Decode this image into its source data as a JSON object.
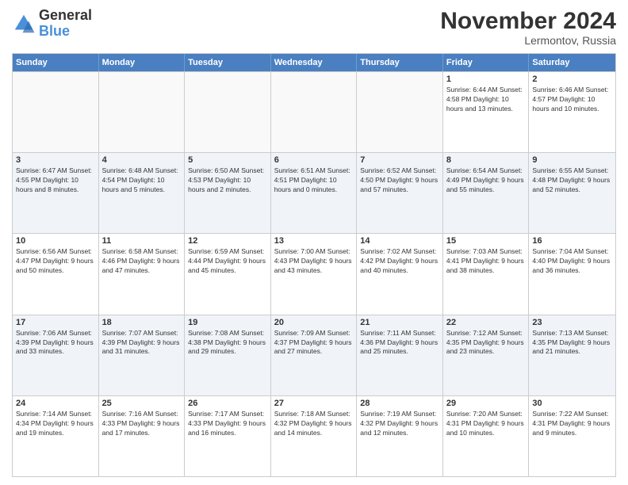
{
  "logo": {
    "text_general": "General",
    "text_blue": "Blue"
  },
  "title": "November 2024",
  "location": "Lermontov, Russia",
  "header_days": [
    "Sunday",
    "Monday",
    "Tuesday",
    "Wednesday",
    "Thursday",
    "Friday",
    "Saturday"
  ],
  "weeks": [
    [
      {
        "day": "",
        "info": "",
        "empty": true
      },
      {
        "day": "",
        "info": "",
        "empty": true
      },
      {
        "day": "",
        "info": "",
        "empty": true
      },
      {
        "day": "",
        "info": "",
        "empty": true
      },
      {
        "day": "",
        "info": "",
        "empty": true
      },
      {
        "day": "1",
        "info": "Sunrise: 6:44 AM\nSunset: 4:58 PM\nDaylight: 10 hours\nand 13 minutes."
      },
      {
        "day": "2",
        "info": "Sunrise: 6:46 AM\nSunset: 4:57 PM\nDaylight: 10 hours\nand 10 minutes."
      }
    ],
    [
      {
        "day": "3",
        "info": "Sunrise: 6:47 AM\nSunset: 4:55 PM\nDaylight: 10 hours\nand 8 minutes."
      },
      {
        "day": "4",
        "info": "Sunrise: 6:48 AM\nSunset: 4:54 PM\nDaylight: 10 hours\nand 5 minutes."
      },
      {
        "day": "5",
        "info": "Sunrise: 6:50 AM\nSunset: 4:53 PM\nDaylight: 10 hours\nand 2 minutes."
      },
      {
        "day": "6",
        "info": "Sunrise: 6:51 AM\nSunset: 4:51 PM\nDaylight: 10 hours\nand 0 minutes."
      },
      {
        "day": "7",
        "info": "Sunrise: 6:52 AM\nSunset: 4:50 PM\nDaylight: 9 hours\nand 57 minutes."
      },
      {
        "day": "8",
        "info": "Sunrise: 6:54 AM\nSunset: 4:49 PM\nDaylight: 9 hours\nand 55 minutes."
      },
      {
        "day": "9",
        "info": "Sunrise: 6:55 AM\nSunset: 4:48 PM\nDaylight: 9 hours\nand 52 minutes."
      }
    ],
    [
      {
        "day": "10",
        "info": "Sunrise: 6:56 AM\nSunset: 4:47 PM\nDaylight: 9 hours\nand 50 minutes."
      },
      {
        "day": "11",
        "info": "Sunrise: 6:58 AM\nSunset: 4:46 PM\nDaylight: 9 hours\nand 47 minutes."
      },
      {
        "day": "12",
        "info": "Sunrise: 6:59 AM\nSunset: 4:44 PM\nDaylight: 9 hours\nand 45 minutes."
      },
      {
        "day": "13",
        "info": "Sunrise: 7:00 AM\nSunset: 4:43 PM\nDaylight: 9 hours\nand 43 minutes."
      },
      {
        "day": "14",
        "info": "Sunrise: 7:02 AM\nSunset: 4:42 PM\nDaylight: 9 hours\nand 40 minutes."
      },
      {
        "day": "15",
        "info": "Sunrise: 7:03 AM\nSunset: 4:41 PM\nDaylight: 9 hours\nand 38 minutes."
      },
      {
        "day": "16",
        "info": "Sunrise: 7:04 AM\nSunset: 4:40 PM\nDaylight: 9 hours\nand 36 minutes."
      }
    ],
    [
      {
        "day": "17",
        "info": "Sunrise: 7:06 AM\nSunset: 4:39 PM\nDaylight: 9 hours\nand 33 minutes."
      },
      {
        "day": "18",
        "info": "Sunrise: 7:07 AM\nSunset: 4:39 PM\nDaylight: 9 hours\nand 31 minutes."
      },
      {
        "day": "19",
        "info": "Sunrise: 7:08 AM\nSunset: 4:38 PM\nDaylight: 9 hours\nand 29 minutes."
      },
      {
        "day": "20",
        "info": "Sunrise: 7:09 AM\nSunset: 4:37 PM\nDaylight: 9 hours\nand 27 minutes."
      },
      {
        "day": "21",
        "info": "Sunrise: 7:11 AM\nSunset: 4:36 PM\nDaylight: 9 hours\nand 25 minutes."
      },
      {
        "day": "22",
        "info": "Sunrise: 7:12 AM\nSunset: 4:35 PM\nDaylight: 9 hours\nand 23 minutes."
      },
      {
        "day": "23",
        "info": "Sunrise: 7:13 AM\nSunset: 4:35 PM\nDaylight: 9 hours\nand 21 minutes."
      }
    ],
    [
      {
        "day": "24",
        "info": "Sunrise: 7:14 AM\nSunset: 4:34 PM\nDaylight: 9 hours\nand 19 minutes."
      },
      {
        "day": "25",
        "info": "Sunrise: 7:16 AM\nSunset: 4:33 PM\nDaylight: 9 hours\nand 17 minutes."
      },
      {
        "day": "26",
        "info": "Sunrise: 7:17 AM\nSunset: 4:33 PM\nDaylight: 9 hours\nand 16 minutes."
      },
      {
        "day": "27",
        "info": "Sunrise: 7:18 AM\nSunset: 4:32 PM\nDaylight: 9 hours\nand 14 minutes."
      },
      {
        "day": "28",
        "info": "Sunrise: 7:19 AM\nSunset: 4:32 PM\nDaylight: 9 hours\nand 12 minutes."
      },
      {
        "day": "29",
        "info": "Sunrise: 7:20 AM\nSunset: 4:31 PM\nDaylight: 9 hours\nand 10 minutes."
      },
      {
        "day": "30",
        "info": "Sunrise: 7:22 AM\nSunset: 4:31 PM\nDaylight: 9 hours\nand 9 minutes."
      }
    ]
  ]
}
